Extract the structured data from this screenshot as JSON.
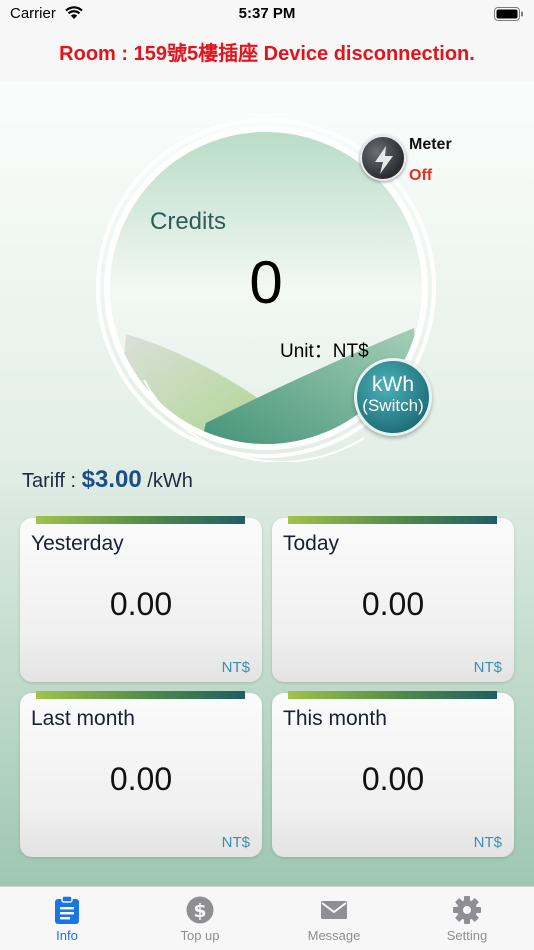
{
  "status_bar": {
    "carrier": "Carrier",
    "time": "5:37 PM"
  },
  "alert": {
    "message": "Room : 159號5樓插座 Device disconnection."
  },
  "gauge": {
    "credits_label": "Credits",
    "credits_value": "0",
    "unit_label": "Unit：",
    "unit_value": "NT$"
  },
  "meter": {
    "label": "Meter",
    "state": "Off",
    "icon": "lightning-icon"
  },
  "switch_button": {
    "unit": "kWh",
    "label": "(Switch)"
  },
  "tariff": {
    "label": "Tariff :",
    "value": "$3.00",
    "unit": "/kWh"
  },
  "cards": [
    {
      "title": "Yesterday",
      "value": "0.00",
      "unit": "NT$"
    },
    {
      "title": "Today",
      "value": "0.00",
      "unit": "NT$"
    },
    {
      "title": "Last month",
      "value": "0.00",
      "unit": "NT$"
    },
    {
      "title": "This month",
      "value": "0.00",
      "unit": "NT$"
    }
  ],
  "tabs": [
    {
      "label": "Info",
      "icon": "clipboard-icon",
      "active": true
    },
    {
      "label": "Top up",
      "icon": "dollar-coin-icon",
      "active": false
    },
    {
      "label": "Message",
      "icon": "envelope-icon",
      "active": false
    },
    {
      "label": "Setting",
      "icon": "gear-icon",
      "active": false
    }
  ],
  "colors": {
    "alert": "#e3141b",
    "meter_off": "#e3341b",
    "tariff_value": "#1b4d86",
    "active_tab": "#1877e6",
    "card_unit": "#3b8fb0"
  }
}
